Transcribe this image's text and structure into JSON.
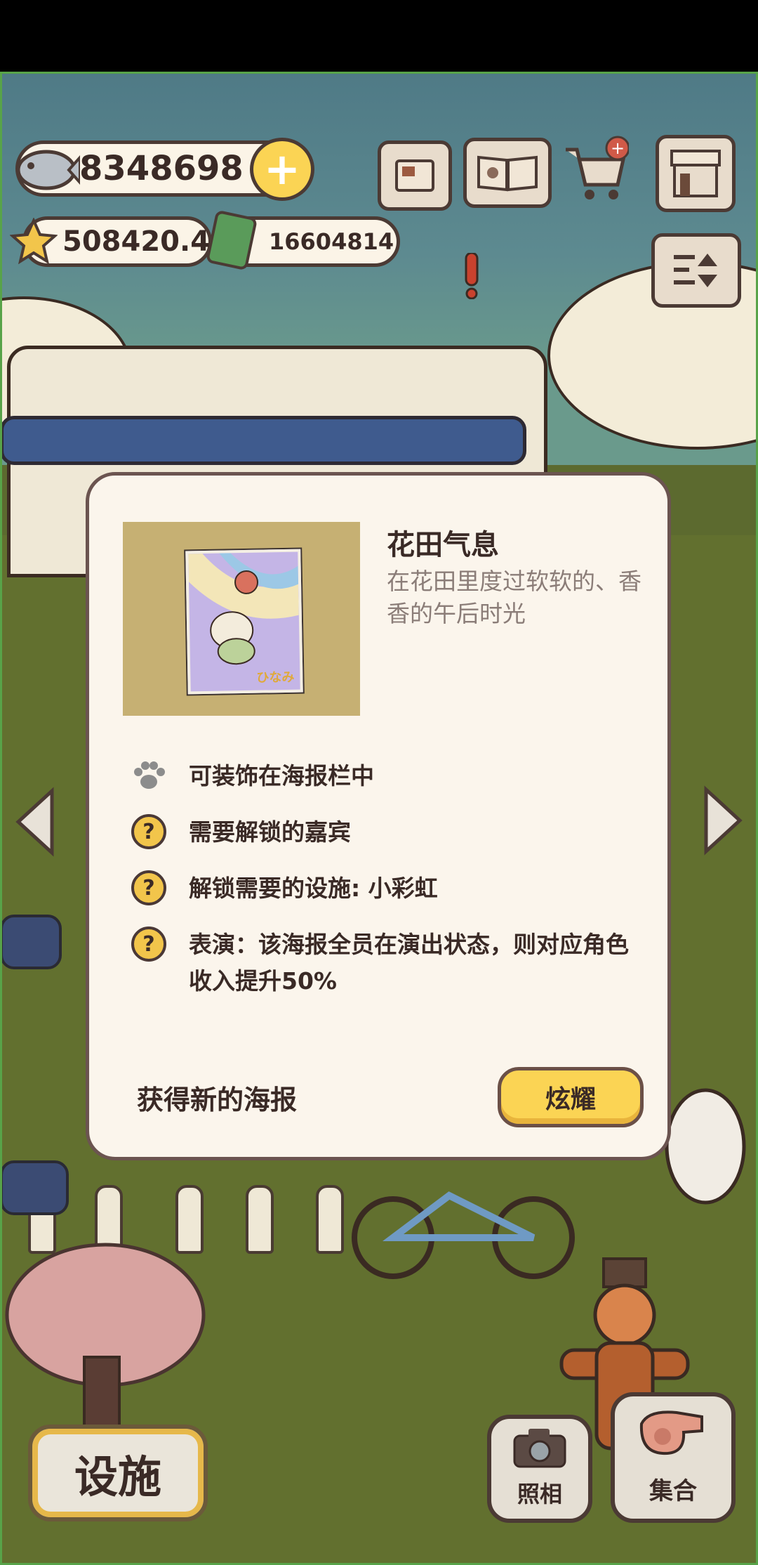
{
  "currencies": {
    "fish": "8348698",
    "star": "508420.4",
    "ticket": "16604814"
  },
  "top_icons": [
    "newspaper-icon",
    "paw-book-icon",
    "shop-cart-icon",
    "store-icon"
  ],
  "dialog": {
    "poster_title": "花田气息",
    "poster_description": "在花田里度过软软的、香香的午后时光",
    "poster_logo_text": "ひなみ",
    "features": [
      {
        "icon": "paw-icon",
        "text": "可装饰在海报栏中"
      },
      {
        "icon": "question-icon",
        "text": "需要解锁的嘉宾"
      },
      {
        "icon": "question-icon",
        "text": "解锁需要的设施: 小彩虹"
      },
      {
        "icon": "question-icon",
        "text": "表演：该海报全员在演出状态，则对应角色收入提升50%"
      }
    ],
    "footer_text": "获得新的海报",
    "show_button": "炫耀"
  },
  "bottom": {
    "facility_button": "设施",
    "photo_button": "照相",
    "gather_button": "集合"
  },
  "colors": {
    "accent_yellow": "#fbd454",
    "dialog_bg": "#fbf5ec",
    "frame_green": "#58a349"
  }
}
